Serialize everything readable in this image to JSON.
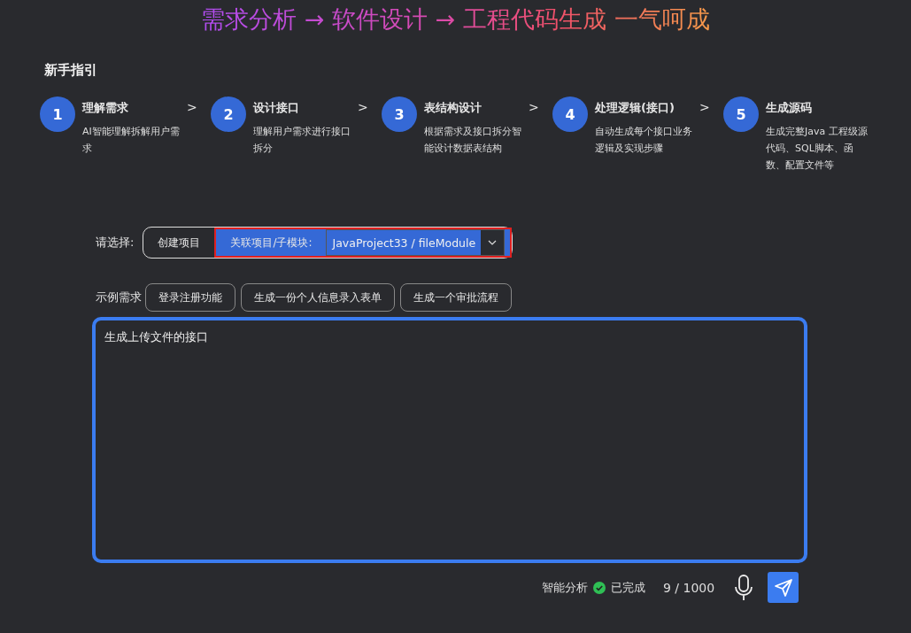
{
  "headline": "需求分析 → 软件设计 → 工程代码生成 一气呵成",
  "guide": {
    "title": "新手指引",
    "separator": ">",
    "steps": [
      {
        "number": "1",
        "title": "理解需求",
        "desc": "AI智能理解拆解用户需求"
      },
      {
        "number": "2",
        "title": "设计接口",
        "desc": "理解用户需求进行接口拆分"
      },
      {
        "number": "3",
        "title": "表结构设计",
        "desc": "根据需求及接口拆分智能设计数据表结构"
      },
      {
        "number": "4",
        "title": "处理逻辑(接口)",
        "desc": "自动生成每个接口业务逻辑及实现步骤"
      },
      {
        "number": "5",
        "title": "生成源码",
        "desc": "生成完整Java 工程级源代码、SQL脚本、函数、配置文件等"
      }
    ]
  },
  "mode": {
    "label": "请选择:",
    "options": [
      {
        "label": "创建项目",
        "selected": false
      },
      {
        "label": "关联项目/子模块:",
        "selected": true
      }
    ],
    "project_select": {
      "value": "JavaProject33 / fileModule"
    }
  },
  "examples": {
    "label": "示例需求",
    "items": [
      "登录注册功能",
      "生成一份个人信息录入表单",
      "生成一个审批流程"
    ]
  },
  "input": {
    "value": "生成上传文件的接口"
  },
  "footer": {
    "analysis_label": "智能分析",
    "status": "已完成",
    "count": "9 / 1000"
  }
}
